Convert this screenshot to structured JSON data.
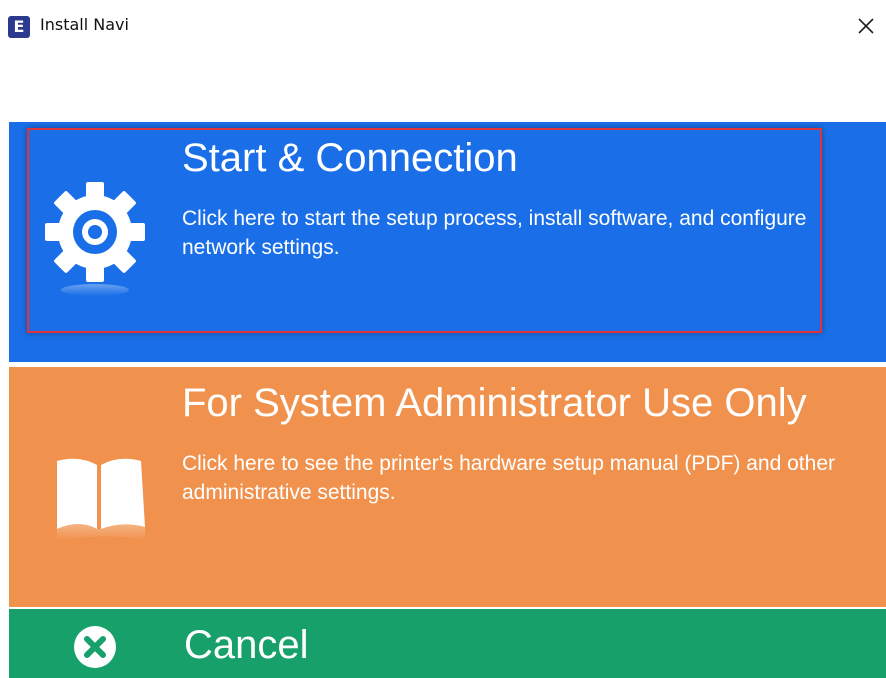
{
  "window": {
    "title": "Install Navi",
    "app_icon_letter": "E",
    "close_icon": "close-icon"
  },
  "panels": {
    "start": {
      "title": "Start & Connection",
      "description": "Click here to start the setup process, install software, and configure network settings.",
      "icon": "gear-icon",
      "color": "#1a6fe8"
    },
    "admin": {
      "title": "For System Administrator Use Only",
      "description": "Click here to see the printer's hardware setup manual (PDF) and other administrative settings.",
      "icon": "book-icon",
      "color": "#f0924d"
    },
    "cancel": {
      "title": "Cancel",
      "icon": "cancel-icon",
      "color": "#17a06a"
    }
  },
  "colors": {
    "highlight_border": "#e0323c"
  }
}
